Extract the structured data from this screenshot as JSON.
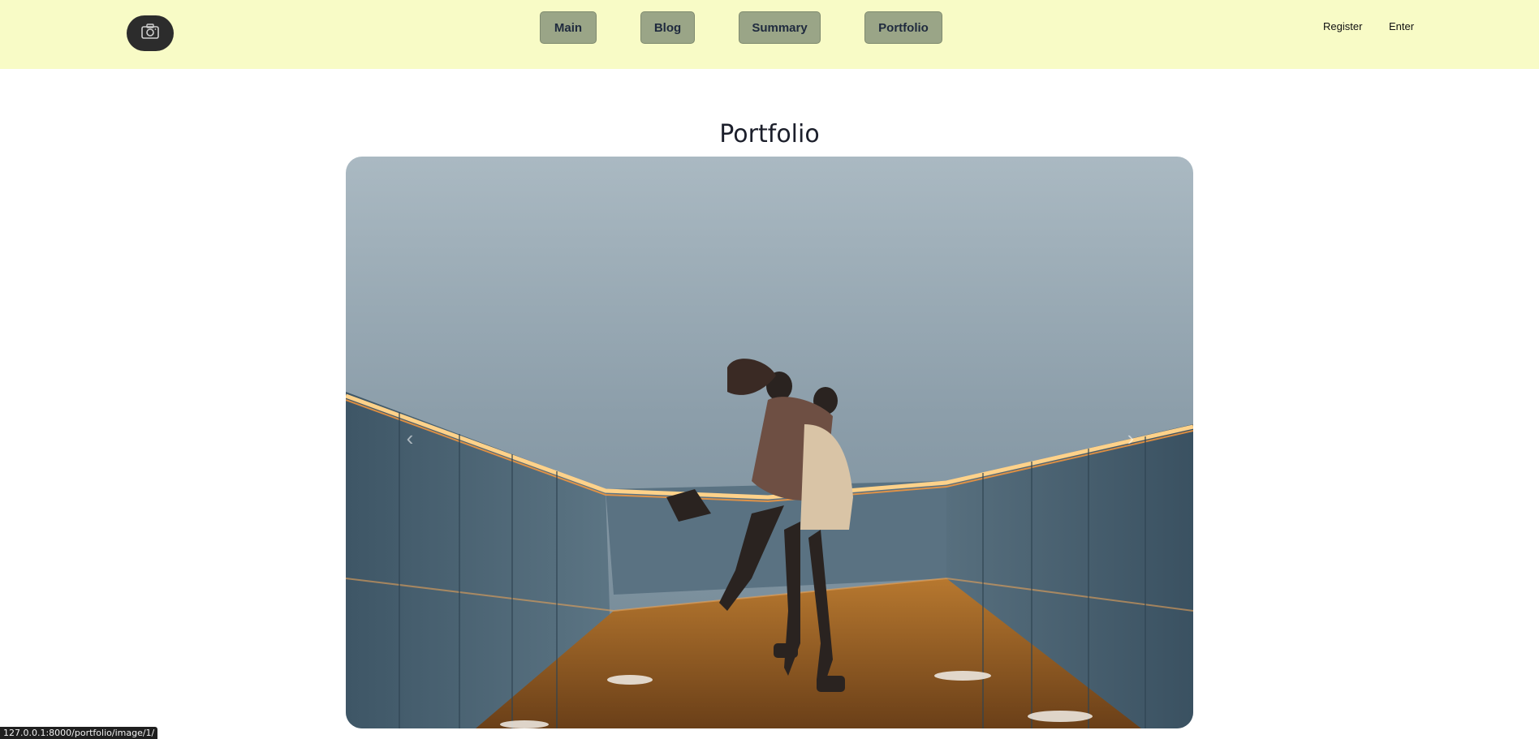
{
  "header": {
    "logo_icon": "camera-icon",
    "nav": [
      {
        "label": "Main"
      },
      {
        "label": "Blog"
      },
      {
        "label": "Summary"
      },
      {
        "label": "Portfolio"
      }
    ],
    "auth": {
      "register_label": "Register",
      "enter_label": "Enter"
    }
  },
  "main": {
    "title": "Portfolio",
    "carousel": {
      "prev_icon": "chevron-left-icon",
      "next_icon": "chevron-right-icon",
      "prev_glyph": "‹",
      "next_glyph": "›"
    }
  },
  "status_bar": {
    "url": "127.0.0.1:8000/portfolio/image/1/"
  },
  "colors": {
    "header_bg": "#f8fbc6",
    "nav_button_bg": "#9aa587",
    "logo_bg": "#2c2c2c"
  }
}
